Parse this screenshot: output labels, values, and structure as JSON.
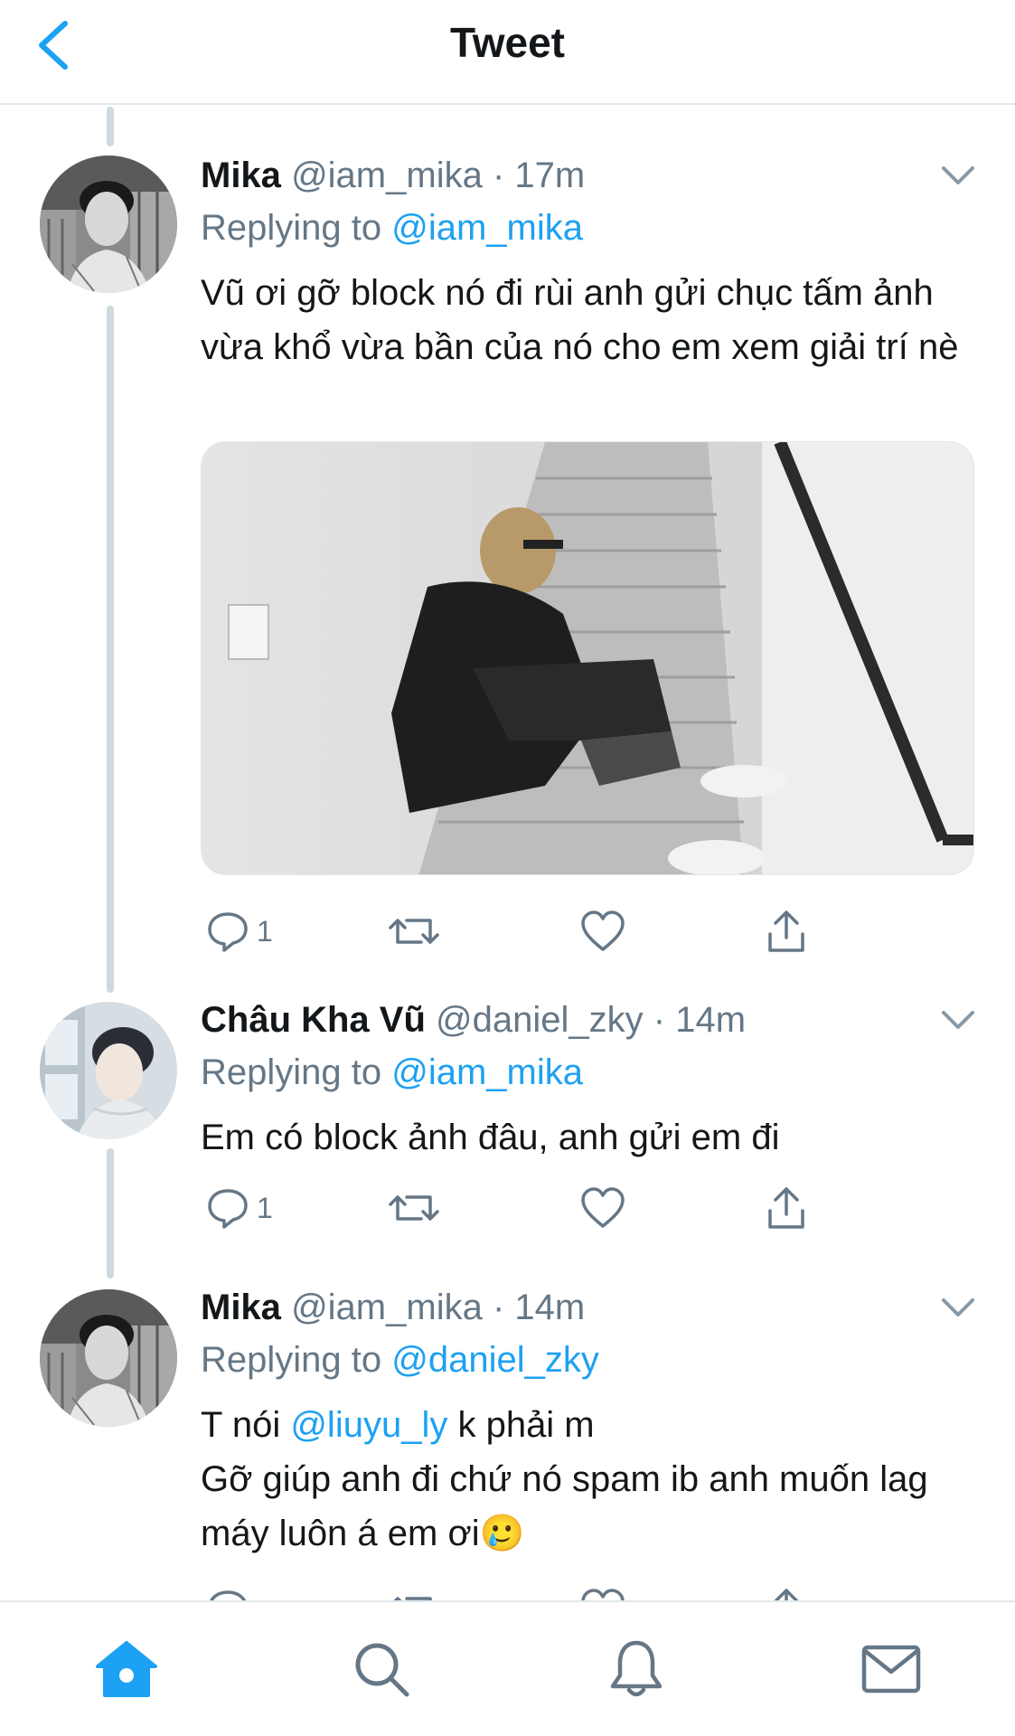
{
  "header": {
    "title": "Tweet"
  },
  "tweets": [
    {
      "name": "Mika",
      "handle": "@iam_mika",
      "dot": "·",
      "time": "17m",
      "replying_prefix": "Replying to ",
      "replying_to": "@iam_mika",
      "text": "Vũ ơi gỡ block nó đi rùi anh gửi chục tấm ảnh vừa khổ vừa bần của nó cho em xem giải trí nè",
      "replies": "1"
    },
    {
      "name": "Châu Kha Vũ",
      "handle": "@daniel_zky",
      "dot": "·",
      "time": "14m",
      "replying_prefix": "Replying to ",
      "replying_to": "@iam_mika",
      "text": "Em có block ảnh đâu, anh gửi em đi",
      "replies": "1"
    },
    {
      "name": "Mika",
      "handle": "@iam_mika",
      "dot": "·",
      "time": "14m",
      "replying_prefix": "Replying to ",
      "replying_to": "@daniel_zky",
      "text_line1_before": "T nói ",
      "text_line1_mention": "@liuyu_ly",
      "text_line1_after": " k phải m",
      "text_line2": "Gỡ giúp anh đi chứ nó spam ib anh muốn lag máy luôn á em ơi",
      "emoji": "🥲"
    }
  ],
  "colors": {
    "accent": "#1da1f2",
    "secondary": "#657786",
    "thread": "#cfd9de"
  },
  "tabbar": [
    "home-icon",
    "search-icon",
    "notifications-icon",
    "messages-icon"
  ]
}
